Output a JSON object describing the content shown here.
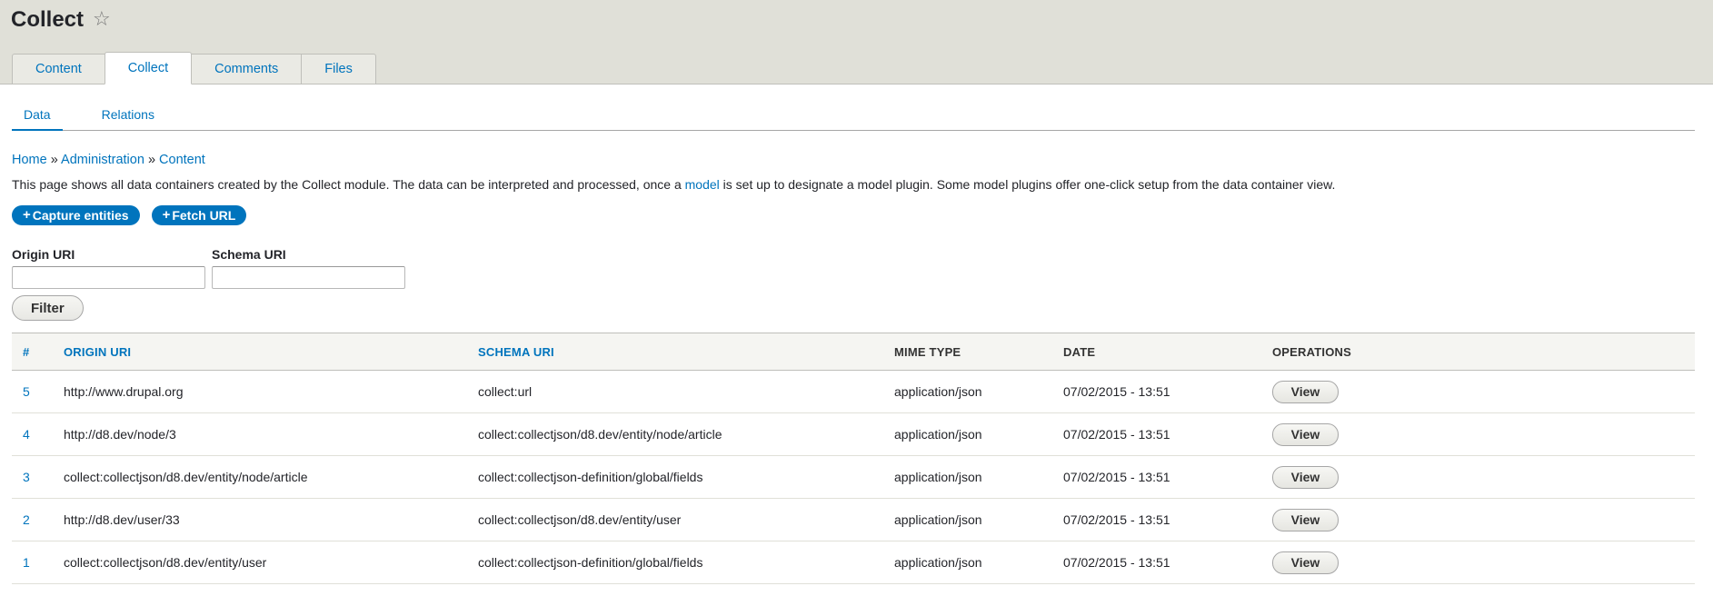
{
  "page": {
    "title": "Collect",
    "star_icon": "star-outline-icon"
  },
  "primary_tabs": [
    {
      "label": "Content",
      "active": false
    },
    {
      "label": "Collect",
      "active": true
    },
    {
      "label": "Comments",
      "active": false
    },
    {
      "label": "Files",
      "active": false
    }
  ],
  "secondary_tabs": [
    {
      "label": "Data",
      "active": true
    },
    {
      "label": "Relations",
      "active": false
    }
  ],
  "breadcrumb": {
    "items": [
      "Home",
      "Administration",
      "Content"
    ],
    "separator": "»"
  },
  "description": {
    "before": "This page shows all data containers created by the Collect module. The data can be interpreted and processed, once a ",
    "link": "model",
    "after": " is set up to designate a model plugin. Some model plugins offer one-click setup from the data container view."
  },
  "actions": [
    {
      "plus": "+",
      "label": "Capture entities"
    },
    {
      "plus": "+",
      "label": "Fetch URL"
    }
  ],
  "filters": {
    "origin_label": "Origin URI",
    "origin_value": "",
    "schema_label": "Schema URI",
    "schema_value": "",
    "submit_label": "Filter"
  },
  "table": {
    "headers": [
      "#",
      "Origin URI",
      "Schema URI",
      "MIME type",
      "Date",
      "Operations"
    ],
    "rows": [
      {
        "id": "5",
        "origin": "http://www.drupal.org",
        "schema": "collect:url",
        "mime": "application/json",
        "date": "07/02/2015 - 13:51",
        "op": "View"
      },
      {
        "id": "4",
        "origin": "http://d8.dev/node/3",
        "schema": "collect:collectjson/d8.dev/entity/node/article",
        "mime": "application/json",
        "date": "07/02/2015 - 13:51",
        "op": "View"
      },
      {
        "id": "3",
        "origin": "collect:collectjson/d8.dev/entity/node/article",
        "schema": "collect:collectjson-definition/global/fields",
        "mime": "application/json",
        "date": "07/02/2015 - 13:51",
        "op": "View"
      },
      {
        "id": "2",
        "origin": "http://d8.dev/user/33",
        "schema": "collect:collectjson/d8.dev/entity/user",
        "mime": "application/json",
        "date": "07/02/2015 - 13:51",
        "op": "View"
      },
      {
        "id": "1",
        "origin": "collect:collectjson/d8.dev/entity/user",
        "schema": "collect:collectjson-definition/global/fields",
        "mime": "application/json",
        "date": "07/02/2015 - 13:51",
        "op": "View"
      }
    ]
  },
  "colors": {
    "link": "#0074bd",
    "header_bg": "#e0e0d8",
    "button_bg": "#0074bd"
  }
}
